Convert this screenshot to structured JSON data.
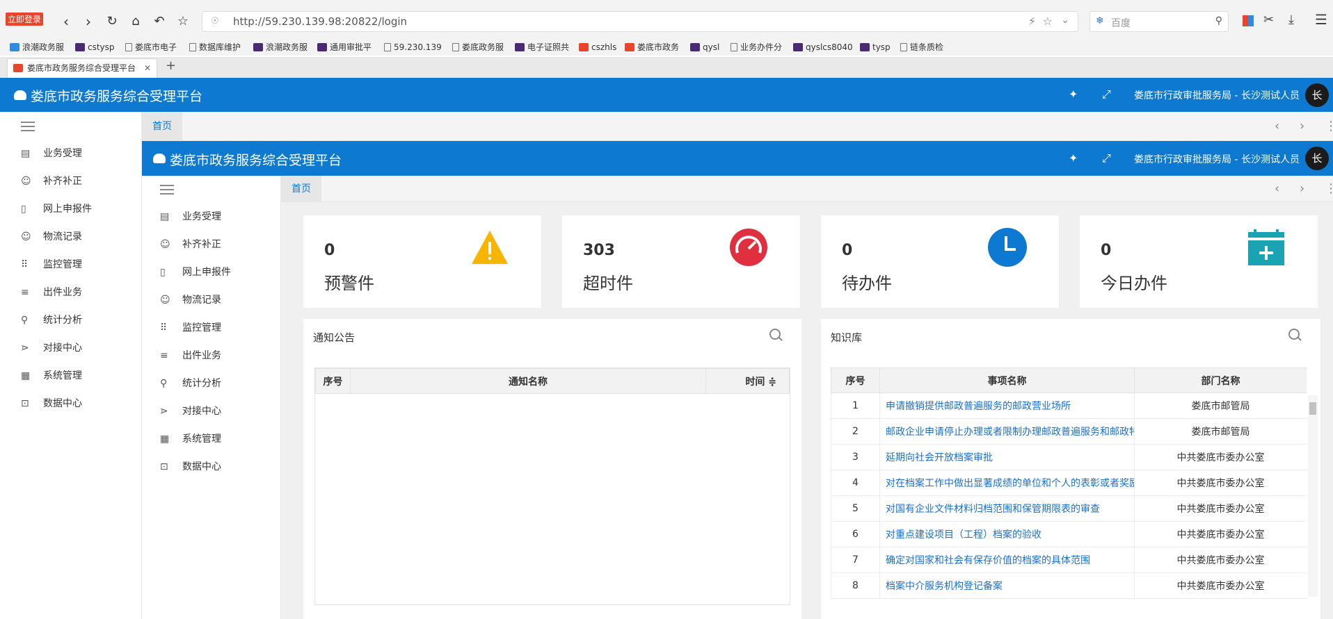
{
  "browser": {
    "login_badge": "立即登录",
    "url": "http://59.230.139.98:20822/login",
    "search_placeholder": "百度",
    "bookmarks": [
      "浪潮政务服",
      "cstysp",
      "娄底市电子",
      "数据库维护",
      "浪潮政务服",
      "通用审批平",
      "59.230.139",
      "娄底政务服",
      "电子证照共",
      "cszhls",
      "娄底市政务",
      "qysl",
      "业务办件分",
      "qyslcs8040",
      "tysp",
      "链条质检"
    ],
    "tab_title": "娄底市政务服务综合受理平台",
    "new_tab": "+"
  },
  "app": {
    "title": "娄底市政务服务综合受理平台",
    "user": "娄底市行政审批服务局 - 长沙测试人员",
    "avatar_text": "长",
    "home_tab": "首页",
    "menu": [
      {
        "label": "业务受理",
        "icon": "list-icon",
        "glyph": "▤"
      },
      {
        "label": "补齐补正",
        "icon": "smile-icon",
        "glyph": "☺"
      },
      {
        "label": "网上申报件",
        "icon": "mobile-icon",
        "glyph": "▯"
      },
      {
        "label": "物流记录",
        "icon": "smile-icon",
        "glyph": "☺"
      },
      {
        "label": "监控管理",
        "icon": "grid-icon",
        "glyph": "⠿"
      },
      {
        "label": "出件业务",
        "icon": "lines-icon",
        "glyph": "≡"
      },
      {
        "label": "统计分析",
        "icon": "search-icon",
        "glyph": "⚲"
      },
      {
        "label": "对接中心",
        "icon": "share-icon",
        "glyph": "⋗"
      },
      {
        "label": "系统管理",
        "icon": "apps-icon",
        "glyph": "▦"
      },
      {
        "label": "数据中心",
        "icon": "download-box-icon",
        "glyph": "⊡"
      }
    ]
  },
  "stats": [
    {
      "value": "0",
      "label": "预警件",
      "icon": "warning-icon",
      "color": "#f7b500"
    },
    {
      "value": "303",
      "label": "超时件",
      "icon": "speedometer-icon",
      "color": "#e0303f"
    },
    {
      "value": "0",
      "label": "待办件",
      "icon": "clock-icon",
      "color": "#0d79d1"
    },
    {
      "value": "0",
      "label": "今日办件",
      "icon": "calendar-add-icon",
      "color": "#1aa3b3"
    }
  ],
  "notice": {
    "title": "通知公告",
    "columns": [
      "序号",
      "通知名称",
      "时间 ≑"
    ]
  },
  "knowledge": {
    "title": "知识库",
    "columns": [
      "序号",
      "事项名称",
      "部门名称"
    ],
    "rows": [
      {
        "idx": "1",
        "name": "申请撤销提供邮政普遍服务的邮政营业场所",
        "dept": "娄底市邮管局"
      },
      {
        "idx": "2",
        "name": "邮政企业申请停止办理或者限制办理邮政普遍服务和邮政特",
        "dept": "娄底市邮管局"
      },
      {
        "idx": "3",
        "name": "延期向社会开放档案审批",
        "dept": "中共娄底市委办公室"
      },
      {
        "idx": "4",
        "name": "对在档案工作中做出显著成绩的单位和个人的表彰或者奖励",
        "dept": "中共娄底市委办公室"
      },
      {
        "idx": "5",
        "name": "对国有企业文件材料归档范围和保管期限表的审查",
        "dept": "中共娄底市委办公室"
      },
      {
        "idx": "6",
        "name": "对重点建设项目（工程）档案的验收",
        "dept": "中共娄底市委办公室"
      },
      {
        "idx": "7",
        "name": "确定对国家和社会有保存价值的档案的具体范围",
        "dept": "中共娄底市委办公室"
      },
      {
        "idx": "8",
        "name": "档案中介服务机构登记备案",
        "dept": "中共娄底市委办公室"
      }
    ]
  }
}
